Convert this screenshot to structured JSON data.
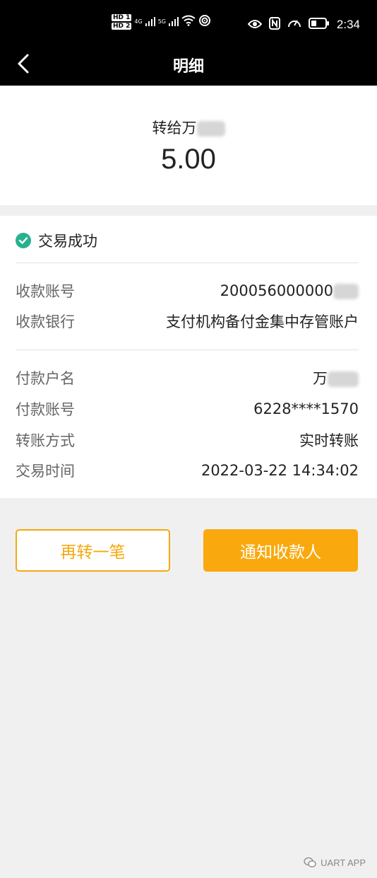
{
  "status_bar": {
    "hd1": "HD 1",
    "hd2": "HD 2",
    "net1": "4G",
    "net2": "5G",
    "time": "2:34"
  },
  "nav": {
    "title": "明细"
  },
  "summary": {
    "recipient_prefix": "转给万",
    "amount": "5.00"
  },
  "detail": {
    "status": "交易成功",
    "rows_a": [
      {
        "label": "收款账号",
        "value": "200056000000"
      },
      {
        "label": "收款银行",
        "value": "支付机构备付金集中存管账户"
      }
    ],
    "rows_b": [
      {
        "label": "付款户名",
        "value": "万"
      },
      {
        "label": "付款账号",
        "value": "6228****1570"
      },
      {
        "label": "转账方式",
        "value": "实时转账"
      },
      {
        "label": "交易时间",
        "value": "2022-03-22 14:34:02"
      }
    ]
  },
  "actions": {
    "again": "再转一笔",
    "notify": "通知收款人"
  },
  "watermark": {
    "text": "UART APP"
  },
  "colors": {
    "accent": "#f9a90e",
    "success": "#27b28f"
  }
}
